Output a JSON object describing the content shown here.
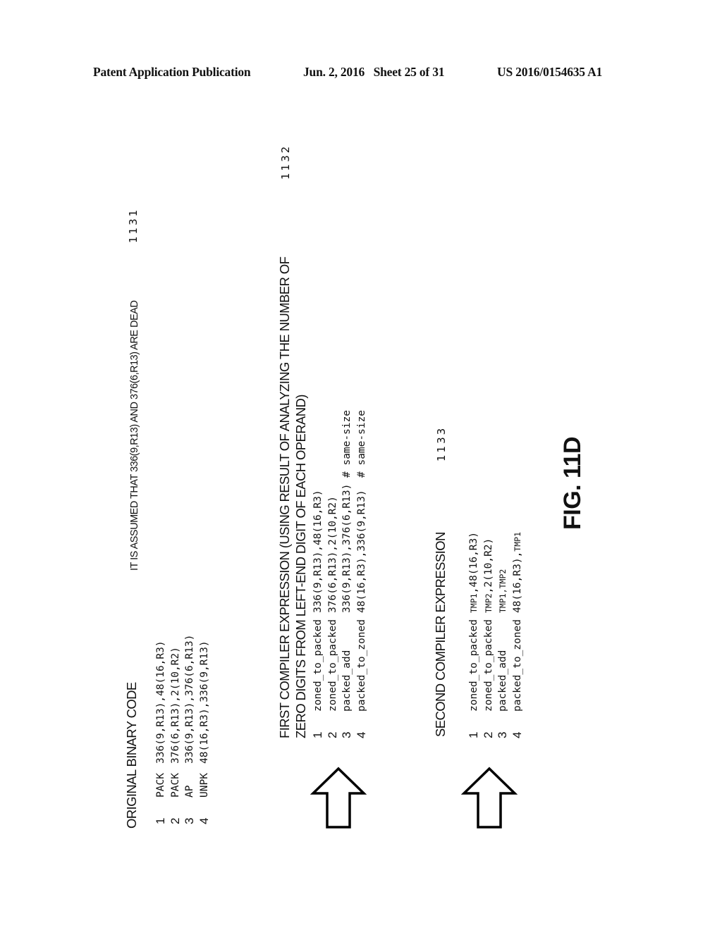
{
  "header": {
    "publication": "Patent Application Publication",
    "date_sheet": "Jun. 2, 2016   Sheet 25 of 31",
    "number": "US 2016/0154635 A1"
  },
  "original": {
    "title": "ORIGINAL BINARY CODE",
    "note": "IT IS ASSUMED THAT 336(9,R13) AND 376(6,R13) ARE DEAD",
    "ref": "1131",
    "rows": [
      {
        "num": "1",
        "op": "PACK",
        "args": "336(9,R13),48(16,R3)"
      },
      {
        "num": "2",
        "op": "PACK",
        "args": "376(6,R13),2(10,R2)"
      },
      {
        "num": "3",
        "op": "AP",
        "args": "336(9,R13),376(6,R13)"
      },
      {
        "num": "4",
        "op": "UNPK",
        "args": "48(16,R3),336(9,R13)"
      }
    ]
  },
  "first": {
    "title_line1": "FIRST COMPILER EXPRESSION (USING RESULT OF ANALYZING THE NUMBER OF",
    "title_line2": "ZERO DIGITS FROM LEFT-END DIGIT OF EACH OPERAND)",
    "ref": "1132",
    "rows": [
      {
        "num": "1",
        "op": "zoned_to_packed",
        "args": "336(9,R13),48(16,R3)",
        "comment": ""
      },
      {
        "num": "2",
        "op": "zoned_to_packed",
        "args": "376(6,R13),2(10,R2)",
        "comment": ""
      },
      {
        "num": "3",
        "op": "packed_add",
        "args": "336(9,R13),376(6,R13)",
        "comment": "# same-size"
      },
      {
        "num": "4",
        "op": "packed_to_zoned",
        "args": "48(16,R3),336(9,R13)",
        "comment": "# same-size"
      }
    ]
  },
  "second": {
    "title": "SECOND COMPILER EXPRESSION",
    "ref": "1133",
    "rows": [
      {
        "num": "1",
        "op": "zoned_to_packed",
        "a": "TMP1",
        "b": ",48(16,R3)"
      },
      {
        "num": "2",
        "op": "zoned_to_packed",
        "a": "TMP2",
        "b": ",2(10,R2)"
      },
      {
        "num": "3",
        "op": "packed_add",
        "a": "TMP1,TMP2",
        "b": ""
      },
      {
        "num": "4",
        "op": "packed_to_zoned",
        "a": "48(16,R3),",
        "b": "TMP1"
      }
    ]
  },
  "arrows": [
    {
      "icon": "up-arrow-icon",
      "meaning": "original binary code to first compiler expression"
    },
    {
      "icon": "up-arrow-icon",
      "meaning": "first compiler expression to second compiler expression"
    }
  ],
  "figure_label": "FIG. 11D"
}
